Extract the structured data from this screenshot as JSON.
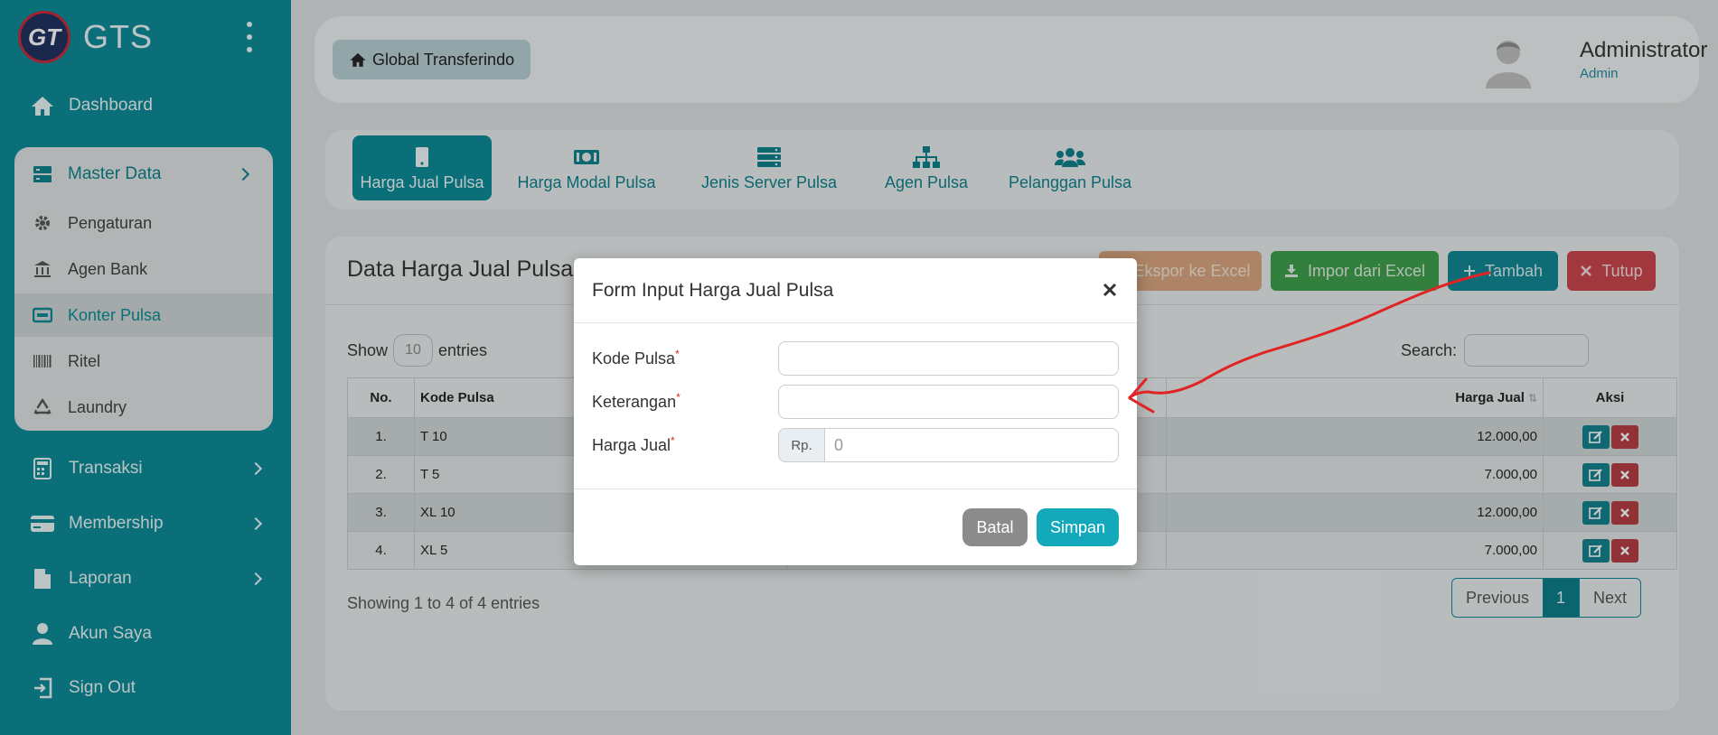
{
  "brand": {
    "logo_text": "GT",
    "name": "GTS"
  },
  "sidebar": {
    "items": [
      {
        "label": "Dashboard",
        "icon": "home-icon"
      },
      {
        "label": "Transaksi",
        "icon": "calculator-icon"
      },
      {
        "label": "Membership",
        "icon": "credit-card-icon"
      },
      {
        "label": "Laporan",
        "icon": "file-icon"
      },
      {
        "label": "Akun Saya",
        "icon": "user-icon"
      },
      {
        "label": "Sign Out",
        "icon": "sign-out-icon"
      }
    ],
    "master_data": {
      "label": "Master Data",
      "children": [
        {
          "label": "Pengaturan",
          "icon": "gear-icon"
        },
        {
          "label": "Agen Bank",
          "icon": "bank-icon"
        },
        {
          "label": "Konter Pulsa",
          "icon": "card-icon",
          "active": true
        },
        {
          "label": "Ritel",
          "icon": "barcode-icon"
        },
        {
          "label": "Laundry",
          "icon": "recycle-icon"
        }
      ]
    }
  },
  "header": {
    "home_label": "Global Transferindo",
    "user_name": "Administrator",
    "user_role": "Admin"
  },
  "tabs": [
    {
      "label": "Harga Jual Pulsa",
      "icon": "mobile-icon",
      "active": true
    },
    {
      "label": "Harga Modal Pulsa",
      "icon": "money-icon"
    },
    {
      "label": "Jenis Server Pulsa",
      "icon": "server-icon"
    },
    {
      "label": "Agen Pulsa",
      "icon": "sitemap-icon"
    },
    {
      "label": "Pelanggan Pulsa",
      "icon": "users-icon"
    }
  ],
  "card": {
    "title": "Data Harga Jual Pulsa",
    "buttons": {
      "export": "Ekspor ke Excel",
      "import": "Impor dari Excel",
      "add": "Tambah",
      "close": "Tutup"
    },
    "show_label": "Show",
    "entries_label": "entries",
    "page_length": "10",
    "search_label": "Search:",
    "table": {
      "headers": {
        "no": "No.",
        "kode": "Kode Pulsa",
        "harga": "Harga Jual",
        "aksi": "Aksi"
      },
      "rows": [
        {
          "no": "1.",
          "kode": "T 10",
          "harga": "12.000,00"
        },
        {
          "no": "2.",
          "kode": "T 5",
          "harga": "7.000,00"
        },
        {
          "no": "3.",
          "kode": "XL 10",
          "harga": "12.000,00"
        },
        {
          "no": "4.",
          "kode": "XL 5",
          "harga": "7.000,00"
        }
      ]
    },
    "info": "Showing 1 to 4 of 4 entries",
    "pager": {
      "prev": "Previous",
      "current": "1",
      "next": "Next"
    }
  },
  "modal": {
    "title": "Form Input Harga Jual Pulsa",
    "fields": {
      "kode": {
        "label": "Kode Pulsa",
        "value": ""
      },
      "keterangan": {
        "label": "Keterangan",
        "value": ""
      },
      "harga": {
        "label": "Harga Jual",
        "addon": "Rp.",
        "placeholder": "0"
      }
    },
    "required_mark": "*",
    "cancel": "Batal",
    "save": "Simpan"
  },
  "colors": {
    "sidebar": "#0a8a97",
    "accent": "#13a8ba",
    "annotation_arrow": "#e02424"
  }
}
